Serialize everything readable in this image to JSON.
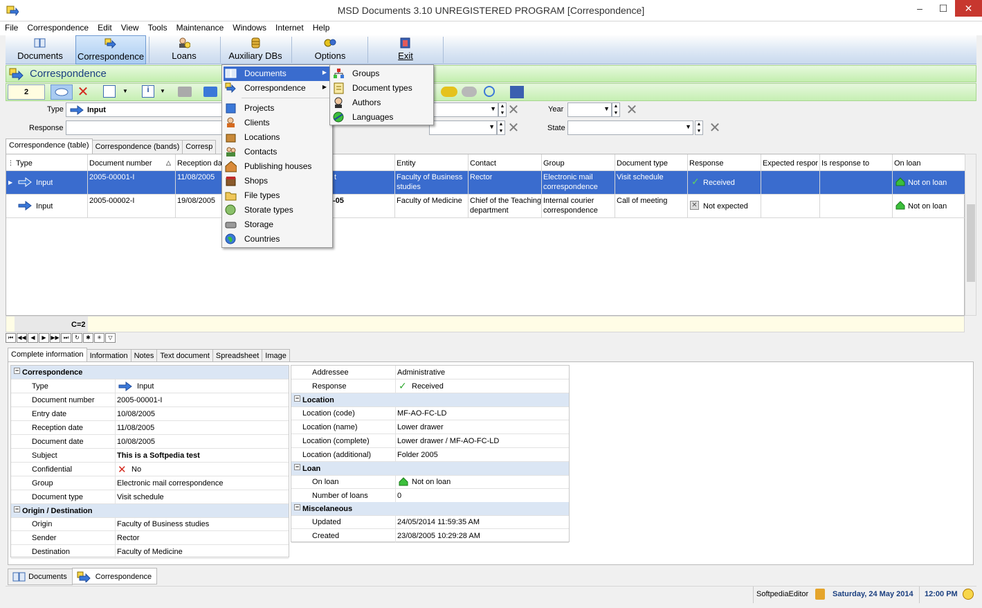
{
  "window": {
    "title": "MSD Documents 3.10 UNREGISTERED PROGRAM [Correspondence]",
    "minimize": "–",
    "maximize": "☐",
    "close": "✕"
  },
  "menu": [
    "File",
    "Correspondence",
    "Edit",
    "View",
    "Tools",
    "Maintenance",
    "Windows",
    "Internet",
    "Help"
  ],
  "bigtoolbar": {
    "documents": "Documents",
    "correspondence": "Correspondence",
    "loans": "Loans",
    "auxiliary": "Auxiliary DBs",
    "options": "Options",
    "exit": "Exit"
  },
  "section_title": "Correspondence",
  "record_counter": "2",
  "filters": {
    "type_label": "Type",
    "type_value": "Input",
    "response_label": "Response",
    "year_label": "Year",
    "state_label": "State"
  },
  "grid_tabs": [
    "Correspondence (table)",
    "Correspondence (bands)",
    "Corresp"
  ],
  "columns": [
    "Type",
    "Document number",
    "Reception da",
    "Entity",
    "Contact",
    "Group",
    "Document type",
    "Response",
    "Expected respor",
    "Is response to",
    "On loan"
  ],
  "rows": [
    {
      "type": "Input",
      "docnum": "2005-00001-I",
      "reception": "11/08/2005",
      "subject_frag": "t",
      "entity": "Faculty of Business studies",
      "contact": "Rector",
      "group": "Electronic mail correspondence",
      "doctype": "Visit schedule",
      "response": "Received",
      "onloan": "Not on loan"
    },
    {
      "type": "Input",
      "docnum": "2005-00002-I",
      "reception": "19/08/2005",
      "subject_frag": "-05",
      "entity": "Faculty of Medicine",
      "contact": "Chief of the Teaching department",
      "group": "Internal courier correspondence",
      "doctype": "Call of meeting",
      "response": "Not expected",
      "onloan": "Not on loan"
    }
  ],
  "footer_count": "C=2",
  "detail_tabs": [
    "Complete information",
    "Information",
    "Notes",
    "Text document",
    "Spreadsheet",
    "Image"
  ],
  "detail_left": {
    "correspondence_header": "Correspondence",
    "rows": [
      [
        "Type",
        "Input"
      ],
      [
        "Document number",
        "2005-00001-I"
      ],
      [
        "Entry date",
        "10/08/2005"
      ],
      [
        "Reception date",
        "11/08/2005"
      ],
      [
        "Document date",
        "10/08/2005"
      ],
      [
        "Subject",
        "This is a Softpedia test"
      ],
      [
        "Confidential",
        "No"
      ],
      [
        "Group",
        "Electronic mail correspondence"
      ],
      [
        "Document type",
        "Visit schedule"
      ]
    ],
    "origin_header": "Origin / Destination",
    "rows2": [
      [
        "Origin",
        "Faculty of Business studies"
      ],
      [
        "Sender",
        "Rector"
      ],
      [
        "Destination",
        "Faculty of Medicine"
      ]
    ]
  },
  "detail_right": {
    "rows0": [
      [
        "Addressee",
        "Administrative"
      ],
      [
        "Response",
        "Received"
      ]
    ],
    "location_header": "Location",
    "location": [
      [
        "Location (code)",
        "MF-AO-FC-LD"
      ],
      [
        "Location (name)",
        "Lower drawer"
      ],
      [
        "Location (complete)",
        "Lower drawer / MF-AO-FC-LD"
      ],
      [
        "Location (additional)",
        "Folder 2005"
      ]
    ],
    "loan_header": "Loan",
    "loan": [
      [
        "On loan",
        "Not on loan"
      ],
      [
        "Number of loans",
        "0"
      ]
    ],
    "misc_header": "Miscelaneous",
    "misc": [
      [
        "Updated",
        "24/05/2014 11:59:35 AM"
      ],
      [
        "Created",
        "23/08/2005 10:29:28 AM"
      ]
    ]
  },
  "bottom_tabs": [
    "Documents",
    "Correspondence"
  ],
  "status": {
    "user": "SoftpediaEditor",
    "date": "Saturday, 24 May 2014",
    "time": "12:00 PM"
  },
  "menu_aux": {
    "items": [
      "Documents",
      "Correspondence",
      "Projects",
      "Clients",
      "Locations",
      "Contacts",
      "Publishing houses",
      "Shops",
      "File types",
      "Storate types",
      "Storage",
      "Countries"
    ]
  },
  "submenu_docs": {
    "items": [
      "Groups",
      "Document types",
      "Authors",
      "Languages"
    ]
  },
  "colors": {
    "accent": "#3a6cce",
    "green": "#c3eeae",
    "header": "#dbe6f4"
  }
}
